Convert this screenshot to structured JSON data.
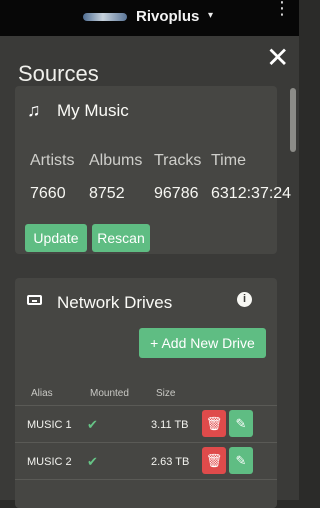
{
  "topbar": {
    "brand": "Rivoplus",
    "caret": "▾",
    "menu": "⋮"
  },
  "page": {
    "title": "Sources",
    "close": "✕"
  },
  "my_music": {
    "title": "My Music",
    "icon": "music-note-icon",
    "columns": [
      "Artists",
      "Albums",
      "Tracks",
      "Time"
    ],
    "values": [
      "7660",
      "8752",
      "96786",
      "6312:37:24"
    ],
    "buttons": {
      "update": "Update",
      "rescan": "Rescan"
    }
  },
  "network_drives": {
    "title": "Network Drives",
    "icon": "hard-drive-icon",
    "info": "i",
    "add_button": "+ Add New Drive",
    "columns": [
      "Alias",
      "Mounted",
      "Size"
    ],
    "rows": [
      {
        "alias": "MUSIC 1",
        "mounted": "✔",
        "size": "3.11 TB"
      },
      {
        "alias": "MUSIC 2",
        "mounted": "✔",
        "size": "2.63 TB"
      }
    ]
  },
  "colors": {
    "accent_green": "#5fbd83",
    "delete_red": "#df4b4b",
    "background": "#3a3a38",
    "card": "#464643"
  }
}
